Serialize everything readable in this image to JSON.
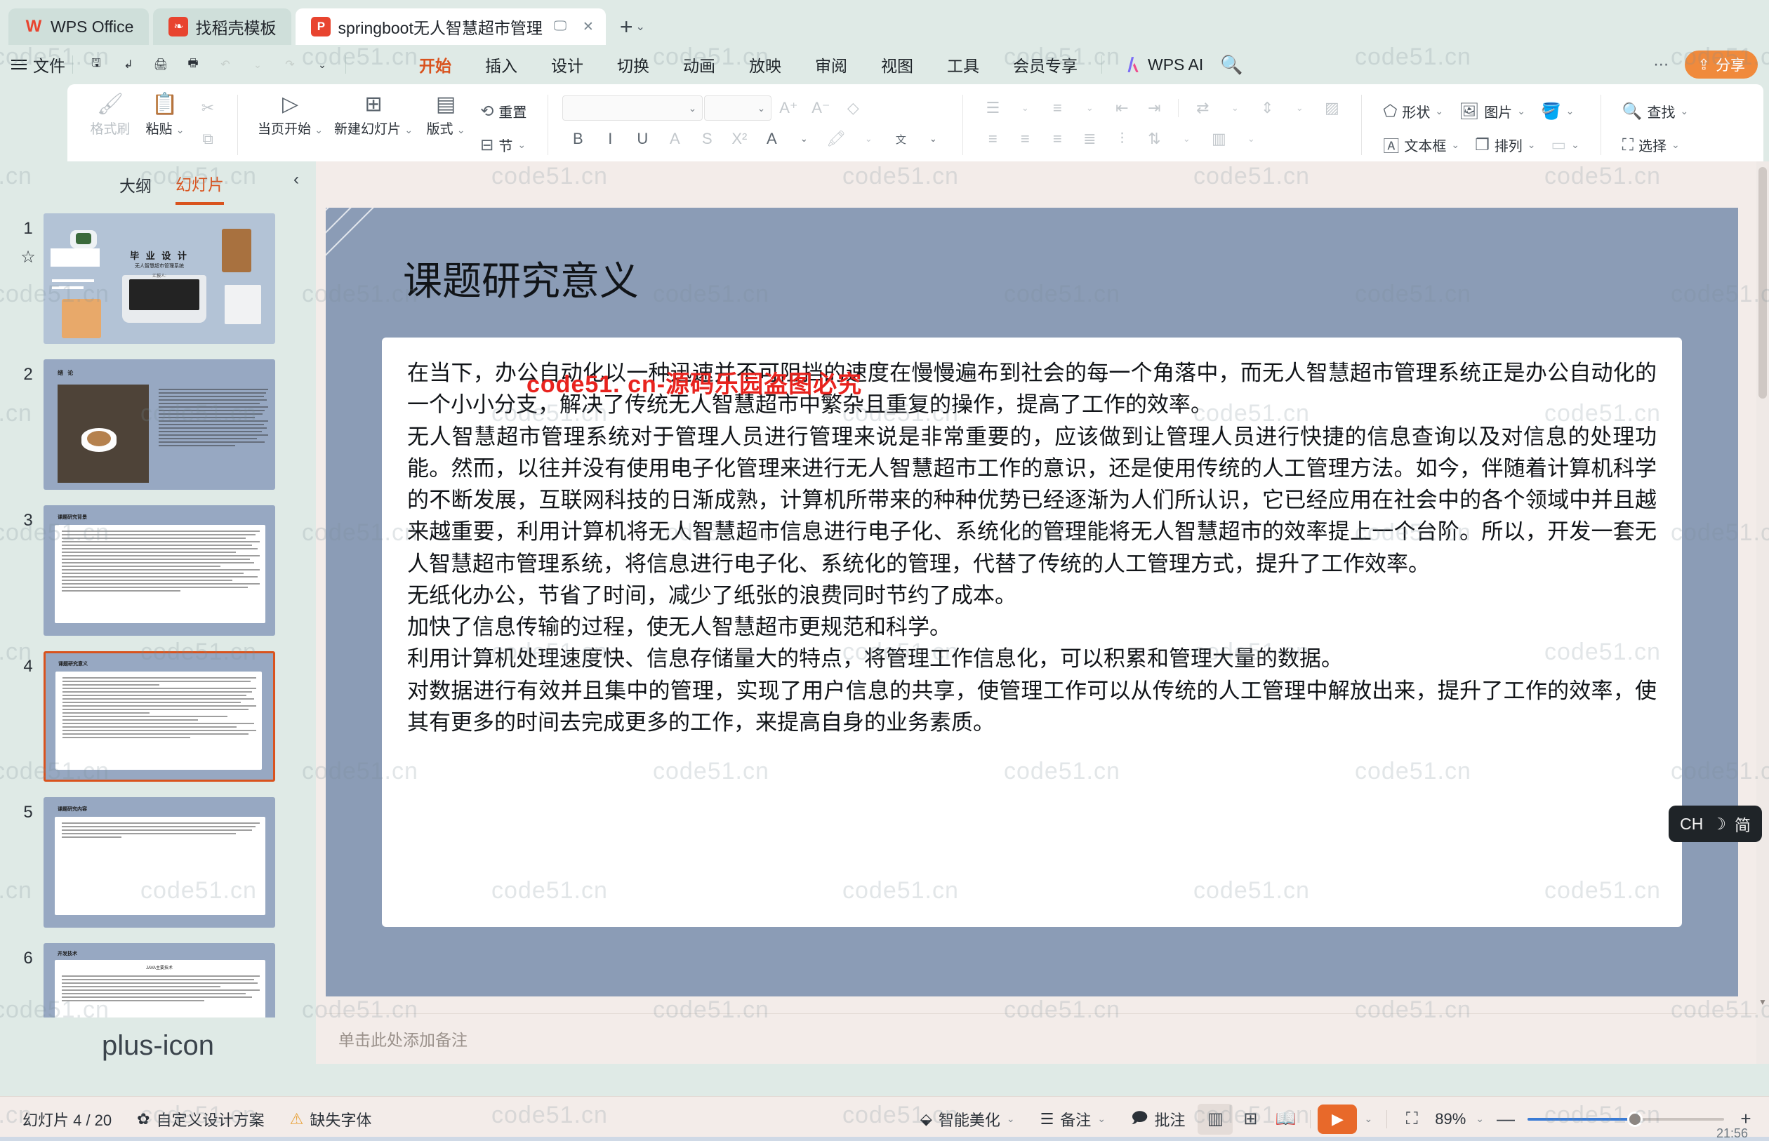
{
  "window": {
    "tabs": [
      {
        "label": "WPS Office",
        "icon": "wps-logo-icon"
      },
      {
        "label": "找稻壳模板",
        "icon": "daoke-icon"
      },
      {
        "label": "springboot无人智慧超市管理",
        "icon": "ppt-file-icon",
        "active": true
      }
    ],
    "new_tab_plus": "+",
    "new_tab_caret": "⌄",
    "controls": {
      "minimize": "—",
      "maximize": "▢",
      "close": "✕"
    },
    "right_icons": [
      "layout-icon",
      "box-icon",
      "display-icon"
    ]
  },
  "menubar": {
    "file_label": "文件",
    "quick_icons": [
      "save-icon",
      "undo-curve-icon",
      "print-icon",
      "print-preview-icon",
      "undo-icon",
      "redo-icon"
    ],
    "ribbon_tabs": [
      {
        "label": "开始",
        "active": true
      },
      {
        "label": "插入",
        "active": false
      },
      {
        "label": "设计",
        "active": false
      },
      {
        "label": "切换",
        "active": false
      },
      {
        "label": "动画",
        "active": false
      },
      {
        "label": "放映",
        "active": false
      },
      {
        "label": "审阅",
        "active": false
      },
      {
        "label": "视图",
        "active": false
      },
      {
        "label": "工具",
        "active": false
      },
      {
        "label": "会员专享",
        "active": false
      }
    ],
    "wps_ai": "WPS AI",
    "search_icon": "search-icon",
    "more_icon": "ellipsis-icon",
    "share_label": "分享"
  },
  "ribbon": {
    "clipboard": {
      "format_painter": "格式刷",
      "paste": "粘贴",
      "cut_icon": "scissors-icon",
      "copy_icon": "copy-icon"
    },
    "slides": {
      "start_here": "当页开始",
      "new_slide": "新建幻灯片",
      "layout": "版式",
      "section": "节",
      "reset": "重置"
    },
    "font": {
      "font_name_value": "",
      "font_size_value": "",
      "grow_icon": "font-grow-icon",
      "shrink_icon": "font-shrink-icon",
      "clear_format_icon": "clear-format-icon",
      "bold": "B",
      "italic": "I",
      "underline": "U",
      "strike": "A",
      "shadow": "S",
      "superscript": "X²",
      "font_color_icon": "font-color-icon",
      "highlight_icon": "highlight-icon",
      "phonetic_icon": "pinyin-icon"
    },
    "paragraph": {
      "bullets_icon": "bullet-list-icon",
      "numbering_icon": "numbered-list-icon",
      "decrease_indent_icon": "decrease-indent-icon",
      "increase_indent_icon": "increase-indent-icon",
      "align_left_icon": "align-left-icon",
      "align_center_icon": "align-center-icon",
      "align_right_icon": "align-right-icon",
      "justify_icon": "justify-icon",
      "text_direction_icon": "text-direction-icon",
      "line_spacing_icon": "line-spacing-icon",
      "columns_icon": "columns-icon",
      "smartart_icon": "smartart-icon"
    },
    "insert": {
      "shape": "形状",
      "picture": "图片",
      "fill_icon": "fill-icon",
      "textbox": "文本框",
      "arrange": "排列",
      "style_icon": "shape-style-icon"
    },
    "edit": {
      "find": "查找",
      "select": "选择"
    }
  },
  "leftpane": {
    "tabs": [
      {
        "label": "大纲",
        "active": false
      },
      {
        "label": "幻灯片",
        "active": true
      }
    ],
    "collapse_icon": "chevron-left-icon",
    "add_slide_icon": "plus-icon",
    "slides": [
      {
        "number": "1",
        "starred": true,
        "title": "毕 业 设 计",
        "subtitle": "无人智慧超市管理系统",
        "presenter": "汇报人:",
        "kind": "cover"
      },
      {
        "number": "2",
        "starred": false,
        "title": "绪 论",
        "kind": "image-text"
      },
      {
        "number": "3",
        "starred": false,
        "title": "课题研究背景",
        "kind": "text"
      },
      {
        "number": "4",
        "starred": false,
        "title": "课题研究意义",
        "kind": "text",
        "selected": true
      },
      {
        "number": "5",
        "starred": false,
        "title": "课题研究内容",
        "kind": "text"
      },
      {
        "number": "6",
        "starred": false,
        "title": "开发技术",
        "subtitle": "JAVA主要技术",
        "kind": "text"
      }
    ]
  },
  "slide": {
    "title": "课题研究意义",
    "paragraphs": [
      "在当下，办公自动化以一种迅速并不可阻挡的速度在慢慢遍布到社会的每一个角落中，而无人智慧超市管理系统正是办公自动化的一个小小分支，解决了传统无人智慧超市中繁杂且重复的操作，提高了工作的效率。",
      "无人智慧超市管理系统对于管理人员进行管理来说是非常重要的，应该做到让管理人员进行快捷的信息查询以及对信息的处理功能。然而，以往并没有使用电子化管理来进行无人智慧超市工作的意识，还是使用传统的人工管理方法。如今，伴随着计算机科学的不断发展，互联网科技的日渐成熟，计算机所带来的种种优势已经逐渐为人们所认识，它已经应用在社会中的各个领域中并且越来越重要，利用计算机将无人智慧超市信息进行电子化、系统化的管理能将无人智慧超市的效率提上一个台阶。所以，开发一套无人智慧超市管理系统，将信息进行电子化、系统化的管理，代替了传统的人工管理方式，提升了工作效率。",
      "无纸化办公，节省了时间，减少了纸张的浪费同时节约了成本。",
      "加快了信息传输的过程，使无人智慧超市更规范和科学。",
      "利用计算机处理速度快、信息存储量大的特点，将管理工作信息化，可以积累和管理大量的数据。",
      "对数据进行有效并且集中的管理，实现了用户信息的共享，使管理工作可以从传统的人工管理中解放出来，提升了工作的效率，使其有更多的时间去完成更多的工作，来提高自身的业务素质。"
    ],
    "notes_placeholder": "单击此处添加备注",
    "red_watermark": "code51. cn-源码乐园盗图必究",
    "page_watermark": "code51.cn",
    "background_color": "#8b9cb6"
  },
  "ime": {
    "lang": "CH",
    "mode_icon": "moon-icon",
    "script": "简"
  },
  "statusbar": {
    "slide_counter": "幻灯片 4 / 20",
    "design_scheme": "自定义设计方案",
    "missing_font": "缺失字体",
    "beautify": "智能美化",
    "notes": "备注",
    "comments": "批注",
    "view_icons": [
      "normal-view-icon",
      "slide-sorter-icon",
      "reading-view-icon"
    ],
    "play_icon": "play-icon",
    "fit_icon": "fit-to-window-icon",
    "zoom_value": "89%",
    "zoom_out": "—",
    "zoom_in": "+",
    "clock": "21:56"
  },
  "colors": {
    "accent_orange": "#d9531e",
    "chrome_green": "#dfeae6",
    "slide_bg": "#8b9cb6",
    "status_bg": "#f3ece9",
    "watermark_red": "#e8231e"
  }
}
